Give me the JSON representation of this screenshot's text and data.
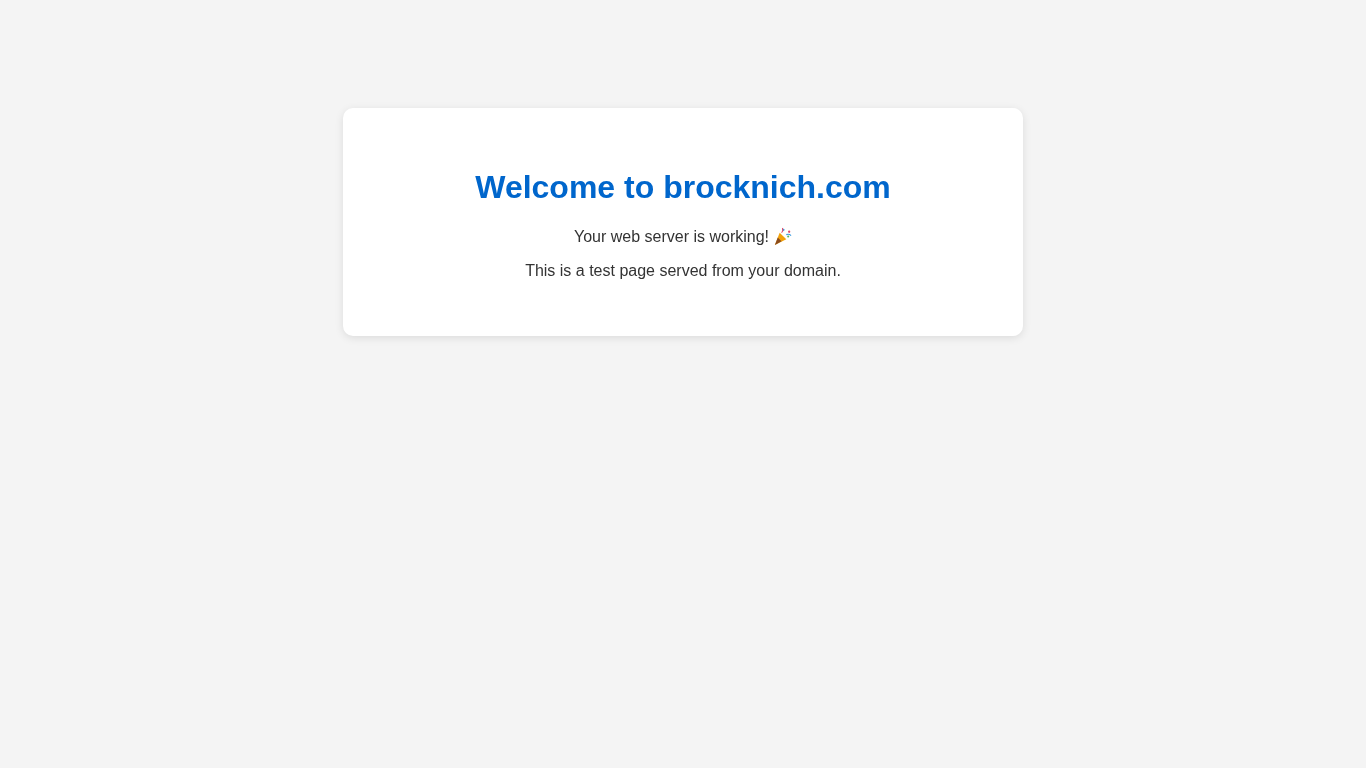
{
  "card": {
    "title": "Welcome to brocknich.com",
    "lines": [
      {
        "text": "Your web server is working!",
        "kind": "celebrate"
      },
      {
        "text": "This is a test page served from your domain.",
        "kind": "plain"
      }
    ]
  }
}
